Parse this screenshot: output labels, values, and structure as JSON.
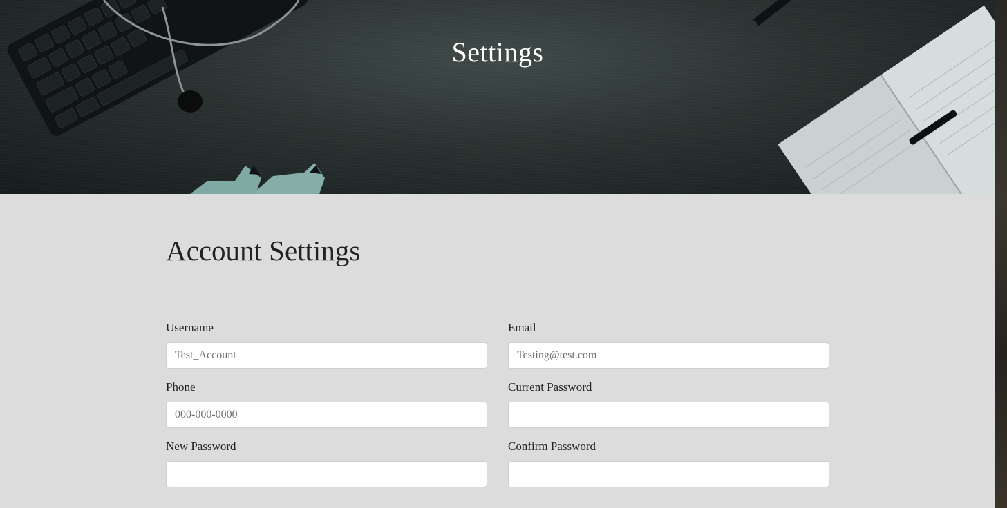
{
  "hero": {
    "title": "Settings"
  },
  "account": {
    "heading": "Account Settings",
    "fields": {
      "username": {
        "label": "Username",
        "placeholder": "Test_Account",
        "value": ""
      },
      "email": {
        "label": "Email",
        "placeholder": "Testing@test.com",
        "value": ""
      },
      "phone": {
        "label": "Phone",
        "placeholder": "000-000-0000",
        "value": ""
      },
      "current_password": {
        "label": "Current Password",
        "placeholder": "",
        "value": ""
      },
      "new_password": {
        "label": "New Password",
        "placeholder": "",
        "value": ""
      },
      "confirm_password": {
        "label": "Confirm Password",
        "placeholder": "",
        "value": ""
      }
    }
  },
  "colors": {
    "content_background": "#dcdcdc",
    "hero_text": "#ffffff",
    "input_background": "#ffffff"
  }
}
